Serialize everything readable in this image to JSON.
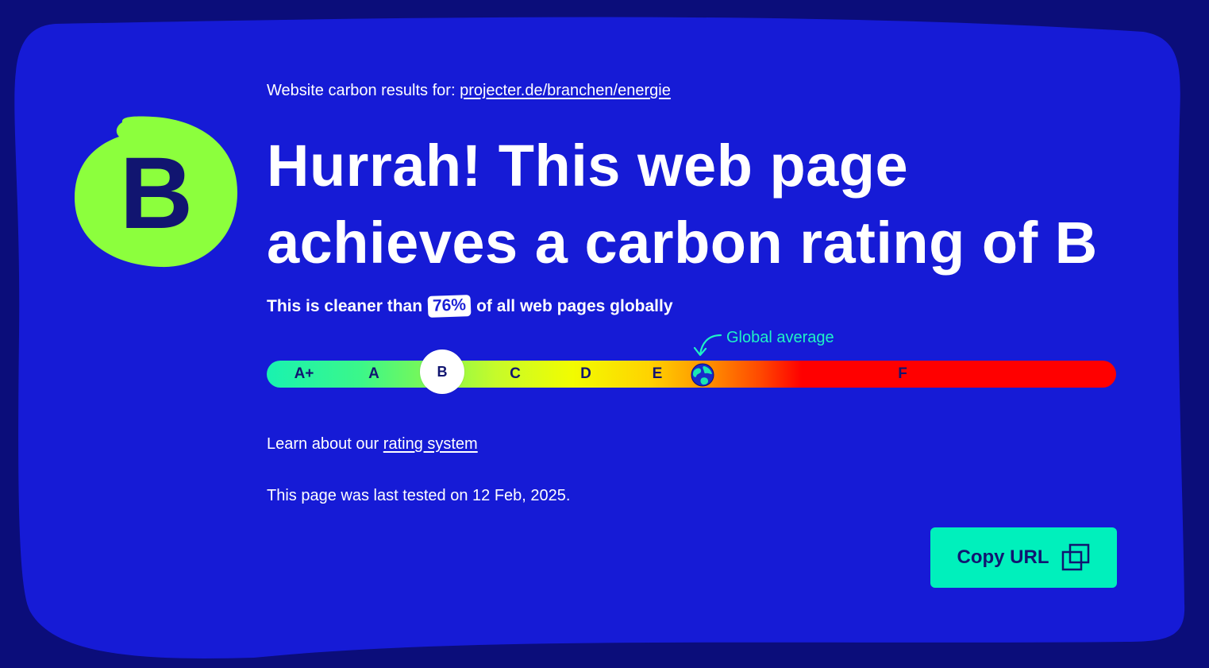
{
  "colors": {
    "page_bg": "#0b0d7a",
    "card_bg": "#161bd6",
    "grade_blob": "#8cff3d",
    "dark_text": "#111570",
    "accent_teal": "#00f0bc"
  },
  "grade": {
    "letter": "B"
  },
  "results": {
    "prefix": "Website carbon results for: ",
    "url": "projecter.de/branchen/energie"
  },
  "headline": "Hurrah! This web page achieves a carbon rating of B",
  "cleaner": {
    "prefix": "This is cleaner than",
    "percent": "76%",
    "suffix": "of all web pages globally"
  },
  "scale": {
    "grades": [
      "A+",
      "A",
      "B",
      "C",
      "D",
      "E",
      "F"
    ],
    "current": "B",
    "global_average_label": "Global average",
    "global_average_icon": "globe-icon"
  },
  "learn": {
    "prefix": "Learn about our ",
    "link": "rating system"
  },
  "tested": "This page was last tested on 12 Feb, 2025.",
  "copy_button": {
    "label": "Copy URL",
    "icon": "copy-icon"
  }
}
